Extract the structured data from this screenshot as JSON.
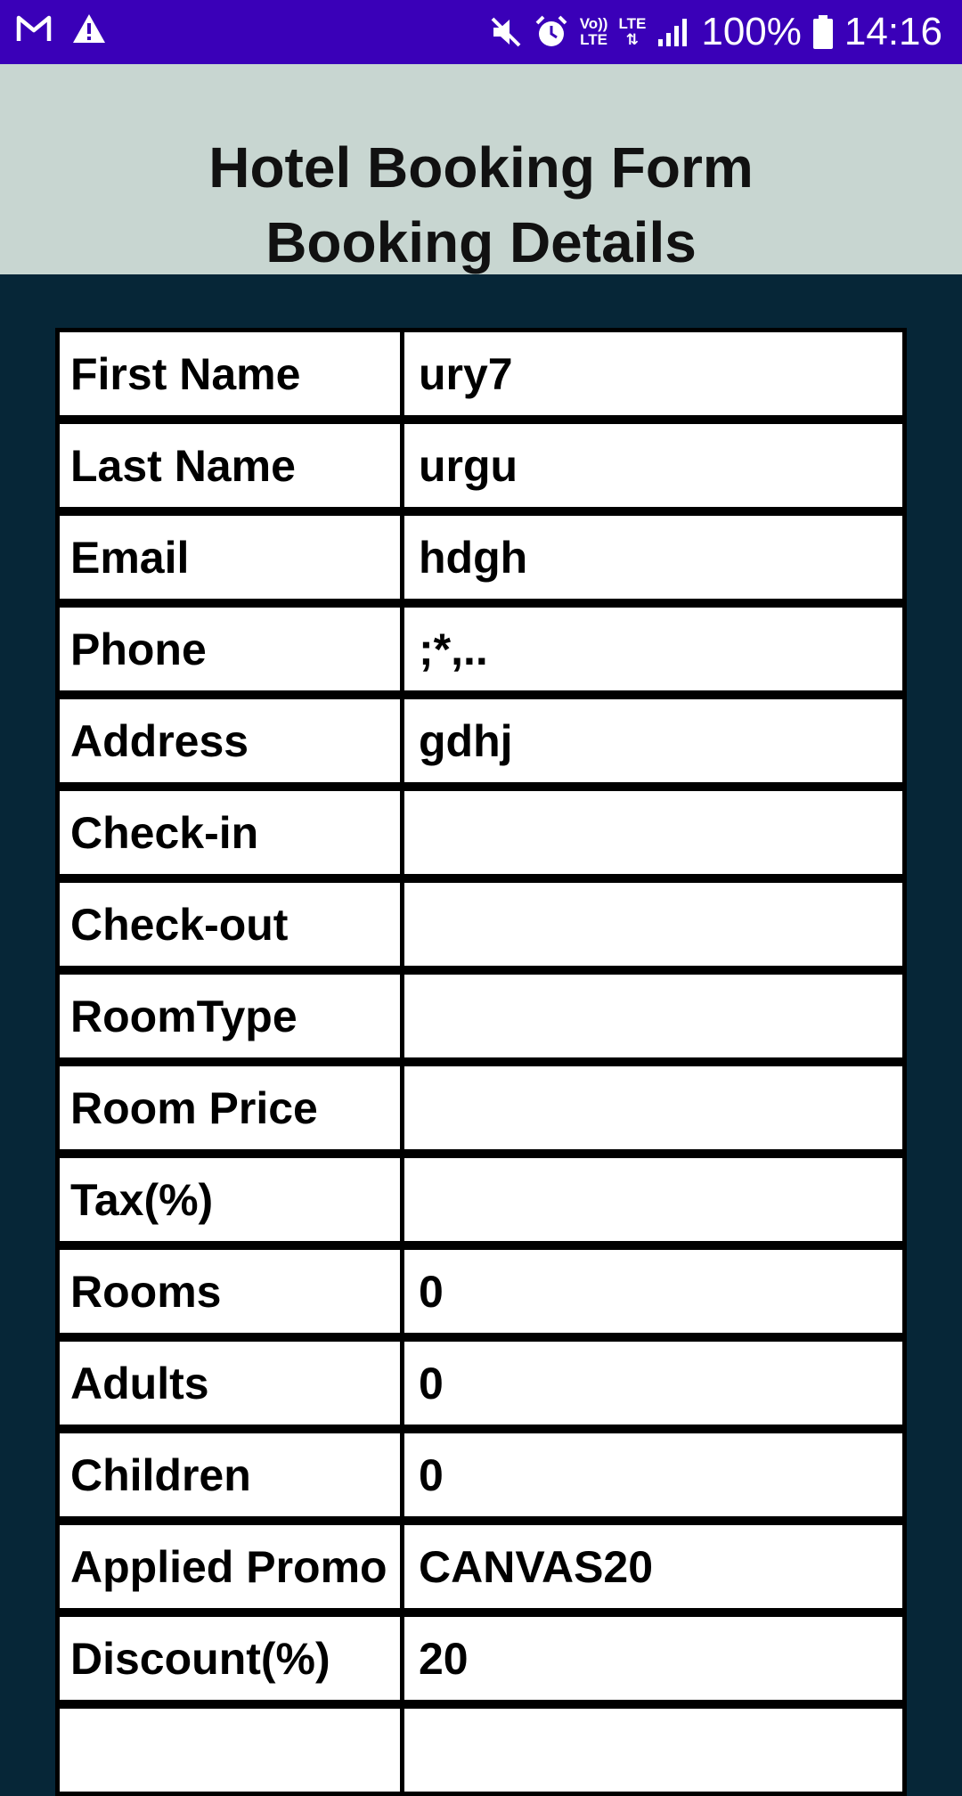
{
  "status_bar": {
    "battery": "100%",
    "time": "14:16",
    "volte_line1": "Vo))",
    "volte_line2": "LTE",
    "lte": "LTE",
    "icons": [
      "gmail-icon",
      "warning-icon",
      "mute-icon",
      "alarm-icon",
      "volte-icon",
      "lte-icon",
      "signal-icon",
      "battery-icon"
    ]
  },
  "header": {
    "title": "Hotel Booking Form",
    "subtitle": "Booking Details"
  },
  "colors": {
    "status_bar": "#3a00b8",
    "header_bg": "#c8d6d1",
    "page_bg": "#062637",
    "cell_bg": "#ffffff",
    "border": "#000000"
  },
  "booking": {
    "rows": [
      {
        "label": "First Name",
        "value": "ury7"
      },
      {
        "label": "Last Name",
        "value": "urgu"
      },
      {
        "label": "Email",
        "value": "hdgh"
      },
      {
        "label": "Phone",
        "value": ";*,.."
      },
      {
        "label": "Address",
        "value": "gdhj"
      },
      {
        "label": "Check-in",
        "value": ""
      },
      {
        "label": "Check-out",
        "value": ""
      },
      {
        "label": "RoomType",
        "value": ""
      },
      {
        "label": "Room Price",
        "value": ""
      },
      {
        "label": "Tax(%)",
        "value": ""
      },
      {
        "label": "Rooms",
        "value": "0"
      },
      {
        "label": "Adults",
        "value": "0"
      },
      {
        "label": "Children",
        "value": "0"
      },
      {
        "label": "Applied Promo",
        "value": "CANVAS20"
      },
      {
        "label": "Discount(%)",
        "value": "20"
      },
      {
        "label": "",
        "value": ""
      }
    ]
  }
}
